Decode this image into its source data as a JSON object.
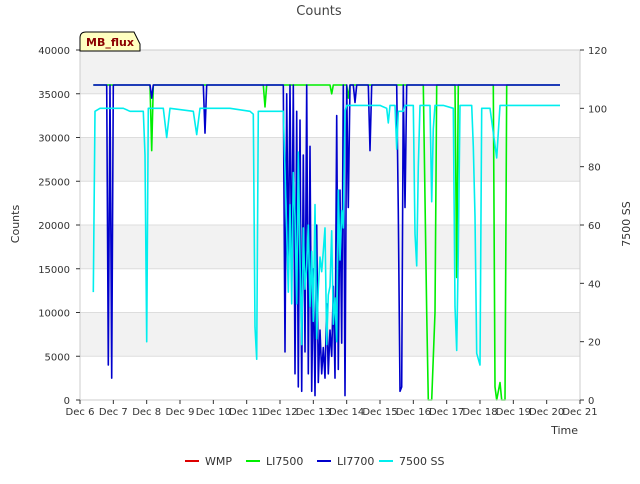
{
  "chart_data": {
    "type": "line",
    "title": "Counts",
    "station_label": "MB_flux",
    "xlabel": "Time",
    "ylabel_left": "Counts",
    "ylabel_right": "7500 SS",
    "x_range": [
      6,
      21
    ],
    "ylim_left": [
      0,
      40000
    ],
    "ylim_right": [
      0,
      120
    ],
    "x_ticks": [
      {
        "x": 6,
        "label": "Dec 6"
      },
      {
        "x": 7,
        "label": "Dec 7"
      },
      {
        "x": 8,
        "label": "Dec 8"
      },
      {
        "x": 9,
        "label": "Dec 9"
      },
      {
        "x": 10,
        "label": "Dec 10"
      },
      {
        "x": 11,
        "label": "Dec 11"
      },
      {
        "x": 12,
        "label": "Dec 12"
      },
      {
        "x": 13,
        "label": "Dec 13"
      },
      {
        "x": 14,
        "label": "Dec 14"
      },
      {
        "x": 15,
        "label": "Dec 15"
      },
      {
        "x": 16,
        "label": "Dec 16"
      },
      {
        "x": 17,
        "label": "Dec 17"
      },
      {
        "x": 18,
        "label": "Dec 18"
      },
      {
        "x": 19,
        "label": "Dec 19"
      },
      {
        "x": 20,
        "label": "Dec 20"
      },
      {
        "x": 21,
        "label": "Dec 21"
      }
    ],
    "y_ticks_left": [
      {
        "v": 0,
        "label": "0"
      },
      {
        "v": 5000,
        "label": "5000"
      },
      {
        "v": 10000,
        "label": "10000"
      },
      {
        "v": 15000,
        "label": "15000"
      },
      {
        "v": 20000,
        "label": "20000"
      },
      {
        "v": 25000,
        "label": "25000"
      },
      {
        "v": 30000,
        "label": "30000"
      },
      {
        "v": 35000,
        "label": "35000"
      },
      {
        "v": 40000,
        "label": "40000"
      }
    ],
    "y_ticks_right": [
      {
        "v": 0,
        "label": "0"
      },
      {
        "v": 20,
        "label": "20"
      },
      {
        "v": 40,
        "label": "40"
      },
      {
        "v": 60,
        "label": "60"
      },
      {
        "v": 80,
        "label": "80"
      },
      {
        "v": 100,
        "label": "100"
      },
      {
        "v": 120,
        "label": "120"
      }
    ],
    "grid": true,
    "legend_position": "bottom",
    "series": [
      {
        "name": "WMP",
        "color": "#dd0000",
        "axis": "left",
        "points": []
      },
      {
        "name": "LI7500",
        "color": "#00ee00",
        "axis": "left",
        "points": [
          [
            6.4,
            36000
          ],
          [
            8.1,
            36000
          ],
          [
            8.15,
            28500
          ],
          [
            8.2,
            36000
          ],
          [
            11.5,
            36000
          ],
          [
            11.55,
            33500
          ],
          [
            11.6,
            36000
          ],
          [
            13.5,
            36000
          ],
          [
            13.55,
            35000
          ],
          [
            13.6,
            36000
          ],
          [
            14.0,
            36000
          ],
          [
            14.05,
            34500
          ],
          [
            14.1,
            36000
          ],
          [
            15.0,
            36000
          ],
          [
            16.3,
            36000
          ],
          [
            16.4,
            10000
          ],
          [
            16.45,
            0
          ],
          [
            16.55,
            0
          ],
          [
            16.65,
            10000
          ],
          [
            16.7,
            36000
          ],
          [
            17.25,
            36000
          ],
          [
            17.3,
            14000
          ],
          [
            17.35,
            36000
          ],
          [
            18.4,
            36000
          ],
          [
            18.45,
            1500
          ],
          [
            18.5,
            0
          ],
          [
            18.6,
            2000
          ],
          [
            18.65,
            0
          ],
          [
            18.75,
            0
          ],
          [
            18.8,
            36000
          ],
          [
            20.4,
            36000
          ]
        ]
      },
      {
        "name": "LI7700",
        "color": "#0000cc",
        "axis": "left",
        "points": [
          [
            6.4,
            36000
          ],
          [
            6.8,
            36000
          ],
          [
            6.85,
            4000
          ],
          [
            6.9,
            36000
          ],
          [
            6.95,
            2500
          ],
          [
            7.0,
            36000
          ],
          [
            8.1,
            36000
          ],
          [
            8.15,
            34500
          ],
          [
            8.2,
            36000
          ],
          [
            9.7,
            36000
          ],
          [
            9.75,
            30500
          ],
          [
            9.8,
            36000
          ],
          [
            12.1,
            36000
          ],
          [
            12.15,
            5500
          ],
          [
            12.2,
            35000
          ],
          [
            12.25,
            14500
          ],
          [
            12.3,
            36000
          ],
          [
            12.35,
            13500
          ],
          [
            12.4,
            36000
          ],
          [
            12.45,
            3000
          ],
          [
            12.5,
            33000
          ],
          [
            12.55,
            1500
          ],
          [
            12.6,
            32000
          ],
          [
            12.65,
            1000
          ],
          [
            12.7,
            28000
          ],
          [
            12.75,
            5500
          ],
          [
            12.8,
            36000
          ],
          [
            12.85,
            3000
          ],
          [
            12.9,
            29000
          ],
          [
            12.95,
            1000
          ],
          [
            13.0,
            15000
          ],
          [
            13.05,
            500
          ],
          [
            13.1,
            20000
          ],
          [
            13.15,
            2000
          ],
          [
            13.2,
            8000
          ],
          [
            13.25,
            3000
          ],
          [
            13.3,
            6000
          ],
          [
            13.35,
            2500
          ],
          [
            13.4,
            11000
          ],
          [
            13.45,
            3000
          ],
          [
            13.5,
            8000
          ],
          [
            13.55,
            5000
          ],
          [
            13.6,
            13000
          ],
          [
            13.65,
            2500
          ],
          [
            13.7,
            32500
          ],
          [
            13.75,
            3500
          ],
          [
            13.8,
            24000
          ],
          [
            13.85,
            6500
          ],
          [
            13.9,
            36000
          ],
          [
            13.95,
            500
          ],
          [
            14.0,
            36000
          ],
          [
            14.05,
            22000
          ],
          [
            14.1,
            36000
          ],
          [
            14.2,
            36000
          ],
          [
            14.25,
            34000
          ],
          [
            14.3,
            36000
          ],
          [
            14.65,
            36000
          ],
          [
            14.7,
            28500
          ],
          [
            14.75,
            36000
          ],
          [
            15.5,
            36000
          ],
          [
            15.55,
            21500
          ],
          [
            15.6,
            1000
          ],
          [
            15.65,
            1500
          ],
          [
            15.7,
            36000
          ],
          [
            15.75,
            22000
          ],
          [
            15.8,
            36000
          ],
          [
            20.4,
            36000
          ]
        ]
      },
      {
        "name": "7500 SS",
        "color": "#00eeee",
        "axis": "right",
        "points": [
          [
            6.4,
            37
          ],
          [
            6.45,
            99
          ],
          [
            6.6,
            100
          ],
          [
            7.0,
            100
          ],
          [
            7.3,
            100
          ],
          [
            7.5,
            99
          ],
          [
            7.9,
            99
          ],
          [
            7.95,
            84
          ],
          [
            8.0,
            20
          ],
          [
            8.05,
            100
          ],
          [
            8.5,
            100
          ],
          [
            8.6,
            90
          ],
          [
            8.7,
            100
          ],
          [
            9.4,
            99
          ],
          [
            9.5,
            91
          ],
          [
            9.6,
            100
          ],
          [
            10.5,
            100
          ],
          [
            11.1,
            99
          ],
          [
            11.2,
            98
          ],
          [
            11.25,
            25
          ],
          [
            11.3,
            14
          ],
          [
            11.35,
            99
          ],
          [
            12.1,
            99
          ],
          [
            12.2,
            58
          ],
          [
            12.25,
            37
          ],
          [
            12.3,
            67
          ],
          [
            12.35,
            33
          ],
          [
            12.4,
            78
          ],
          [
            12.45,
            63
          ],
          [
            12.5,
            33
          ],
          [
            12.55,
            85
          ],
          [
            12.6,
            48
          ],
          [
            12.65,
            19
          ],
          [
            12.7,
            59
          ],
          [
            12.75,
            38
          ],
          [
            12.8,
            46
          ],
          [
            12.85,
            60
          ],
          [
            12.9,
            32
          ],
          [
            12.95,
            51
          ],
          [
            13.0,
            27
          ],
          [
            13.05,
            67
          ],
          [
            13.1,
            21
          ],
          [
            13.15,
            38
          ],
          [
            13.2,
            49
          ],
          [
            13.25,
            44
          ],
          [
            13.3,
            51
          ],
          [
            13.35,
            59
          ],
          [
            13.4,
            19
          ],
          [
            13.45,
            36
          ],
          [
            13.5,
            39
          ],
          [
            13.55,
            58
          ],
          [
            13.6,
            26
          ],
          [
            13.65,
            35
          ],
          [
            13.7,
            20
          ],
          [
            13.75,
            72
          ],
          [
            13.8,
            48
          ],
          [
            13.85,
            65
          ],
          [
            13.9,
            59
          ],
          [
            13.95,
            99
          ],
          [
            14.0,
            101
          ],
          [
            14.5,
            101
          ],
          [
            15.0,
            101
          ],
          [
            15.2,
            100
          ],
          [
            15.25,
            95
          ],
          [
            15.3,
            101
          ],
          [
            15.45,
            101
          ],
          [
            15.5,
            86
          ],
          [
            15.55,
            99
          ],
          [
            15.7,
            99
          ],
          [
            15.75,
            101
          ],
          [
            16.0,
            101
          ],
          [
            16.05,
            57
          ],
          [
            16.1,
            46
          ],
          [
            16.15,
            80
          ],
          [
            16.2,
            101
          ],
          [
            16.5,
            101
          ],
          [
            16.55,
            68
          ],
          [
            16.6,
            93
          ],
          [
            16.65,
            101
          ],
          [
            16.9,
            101
          ],
          [
            17.2,
            100
          ],
          [
            17.25,
            32
          ],
          [
            17.3,
            17
          ],
          [
            17.35,
            51
          ],
          [
            17.4,
            101
          ],
          [
            17.6,
            101
          ],
          [
            17.75,
            101
          ],
          [
            17.8,
            87
          ],
          [
            17.85,
            63
          ],
          [
            17.9,
            16
          ],
          [
            18.0,
            12
          ],
          [
            18.05,
            100
          ],
          [
            18.3,
            100
          ],
          [
            18.5,
            83
          ],
          [
            18.6,
            101
          ],
          [
            19.0,
            101
          ],
          [
            20.4,
            101
          ]
        ]
      }
    ]
  }
}
